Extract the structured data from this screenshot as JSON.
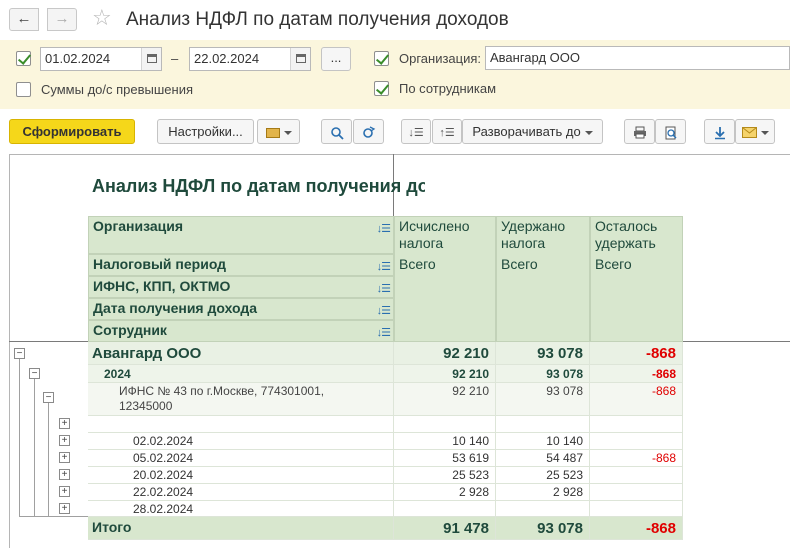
{
  "window": {
    "title": "Анализ НДФЛ по датам получения доходов",
    "back_icon": "arrow-left-icon",
    "forward_icon": "arrow-right-icon",
    "favorite_icon": "star-icon"
  },
  "settings": {
    "period_enabled": true,
    "date_from": "01.02.2024",
    "dash": "–",
    "date_to": "22.02.2024",
    "more_label": "...",
    "amounts_over_label": "Суммы до/с превышения",
    "amounts_over_checked": false,
    "org_enabled": true,
    "org_label": "Организация:",
    "org_value": "Авангард ООО",
    "by_employees_label": "По сотрудникам",
    "by_employees_checked": true
  },
  "toolbar": {
    "generate_label": "Сформировать",
    "settings_label": "Настройки...",
    "expand_label": "Разворачивать до"
  },
  "report": {
    "title": "Анализ НДФЛ по датам получения доходов",
    "group_headers": [
      "Организация",
      "Налоговый период",
      "ИФНС, КПП, ОКТМО",
      "Дата получения дохода",
      "Сотрудник"
    ],
    "col_headers": [
      "Исчислено налога",
      "Удержано налога",
      "Осталось удержать"
    ],
    "col_sub": [
      "Всего",
      "Всего",
      "Всего"
    ],
    "rows": {
      "org": {
        "label": "Авангард ООО",
        "v1": "92 210",
        "v2": "93 078",
        "v3": "-868"
      },
      "year": {
        "label": "2024",
        "v1": "92 210",
        "v2": "93 078",
        "v3": "-868"
      },
      "ifns": {
        "label1": "ИФНС № 43 по г.Москве, 774301001,",
        "label2": "12345000",
        "v1": "92 210",
        "v2": "93 078",
        "v3": "-868"
      },
      "d1": {
        "label": "02.02.2024",
        "v1": "10 140",
        "v2": "10 140",
        "v3": ""
      },
      "d2": {
        "label": "05.02.2024",
        "v1": "53 619",
        "v2": "54 487",
        "v3": "-868"
      },
      "d3": {
        "label": "20.02.2024",
        "v1": "25 523",
        "v2": "25 523",
        "v3": ""
      },
      "d4": {
        "label": "22.02.2024",
        "v1": "2 928",
        "v2": "2 928",
        "v3": ""
      },
      "d5": {
        "label": "28.02.2024",
        "v1": "",
        "v2": "",
        "v3": ""
      },
      "total": {
        "label": "Итого",
        "v1": "91 478",
        "v2": "93 078",
        "v3": "-868"
      }
    }
  },
  "colors": {
    "header_bg": "#d8e7ce",
    "accent_yellow": "#f5d71a",
    "settings_bg": "#fbf6dd",
    "negative": "#e00000"
  }
}
